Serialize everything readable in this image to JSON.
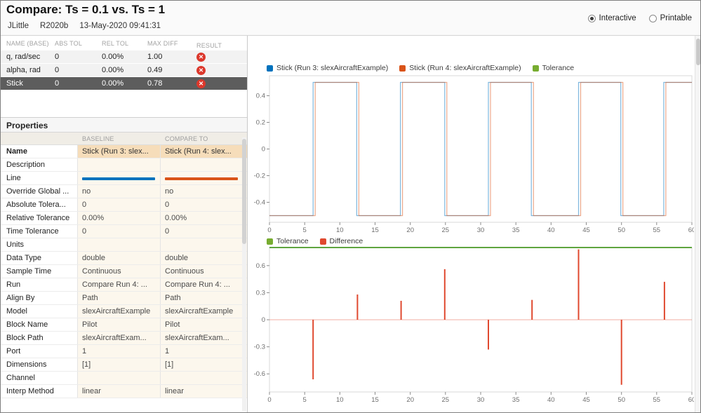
{
  "header": {
    "title": "Compare: Ts = 0.1 vs. Ts = 1",
    "user": "JLittle",
    "release": "R2020b",
    "timestamp": "13-May-2020 09:41:31",
    "view_options": [
      {
        "label": "Interactive",
        "selected": true
      },
      {
        "label": "Printable",
        "selected": false
      }
    ]
  },
  "icons": {
    "fail": "✕"
  },
  "results_table": {
    "columns": [
      "NAME (BASE)",
      "ABS TOL",
      "REL TOL",
      "MAX DIFF",
      "RESULT"
    ],
    "rows": [
      {
        "name": "q, rad/sec",
        "abs_tol": "0",
        "rel_tol": "0.00%",
        "max_diff": "1.00",
        "result": "fail",
        "selected": false
      },
      {
        "name": "alpha, rad",
        "abs_tol": "0",
        "rel_tol": "0.00%",
        "max_diff": "0.49",
        "result": "fail",
        "selected": false
      },
      {
        "name": "Stick",
        "abs_tol": "0",
        "rel_tol": "0.00%",
        "max_diff": "0.78",
        "result": "fail",
        "selected": true
      }
    ]
  },
  "properties": {
    "title": "Properties",
    "columns": [
      "BASELINE",
      "COMPARE TO"
    ],
    "rows": [
      {
        "label": "Name",
        "baseline": "Stick (Run 3: slex...",
        "compare": "Stick (Run 4: slex...",
        "highlight": true
      },
      {
        "label": "Description",
        "baseline": "",
        "compare": ""
      },
      {
        "label": "Line",
        "type": "line",
        "baseline_color": "#0072bd",
        "compare_color": "#d95319",
        "baseline": "",
        "compare": ""
      },
      {
        "label": "Override Global ...",
        "baseline": "no",
        "compare": "no"
      },
      {
        "label": "Absolute Tolera...",
        "baseline": "0",
        "compare": "0"
      },
      {
        "label": "Relative Tolerance",
        "baseline": "0.00%",
        "compare": "0.00%"
      },
      {
        "label": "Time Tolerance",
        "baseline": "0",
        "compare": "0"
      },
      {
        "label": "Units",
        "baseline": "",
        "compare": ""
      },
      {
        "label": "Data Type",
        "baseline": "double",
        "compare": "double"
      },
      {
        "label": "Sample Time",
        "baseline": "Continuous",
        "compare": "Continuous"
      },
      {
        "label": "Run",
        "baseline": "Compare Run 4: ...",
        "compare": "Compare Run 4: ..."
      },
      {
        "label": "Align By",
        "baseline": "Path",
        "compare": "Path"
      },
      {
        "label": "Model",
        "baseline": "slexAircraftExample",
        "compare": "slexAircraftExample"
      },
      {
        "label": "Block Name",
        "baseline": "Pilot",
        "compare": "Pilot"
      },
      {
        "label": "Block Path",
        "baseline": "slexAircraftExam...",
        "compare": "slexAircraftExam..."
      },
      {
        "label": "Port",
        "baseline": "1",
        "compare": "1"
      },
      {
        "label": "Dimensions",
        "baseline": "[1]",
        "compare": "[1]"
      },
      {
        "label": "Channel",
        "baseline": "",
        "compare": ""
      },
      {
        "label": "Interp Method",
        "baseline": "linear",
        "compare": "linear"
      }
    ]
  },
  "chart_data": [
    {
      "type": "line",
      "title": "signals-comparison",
      "legend": [
        {
          "label": "Stick (Run 3: slexAircraftExample)",
          "color": "#0072bd"
        },
        {
          "label": "Stick (Run 4: slexAircraftExample)",
          "color": "#d95319"
        },
        {
          "label": "Tolerance",
          "color": "#77ac30"
        }
      ],
      "xlim": [
        0,
        60
      ],
      "ylim": [
        -0.55,
        0.55
      ],
      "xticks": [
        0,
        5,
        10,
        15,
        20,
        25,
        30,
        35,
        40,
        45,
        50,
        55,
        60
      ],
      "yticks": [
        -0.4,
        -0.2,
        0,
        0.2,
        0.4
      ],
      "grid": false,
      "series": [
        {
          "name": "Stick (Run 3: slexAircraftExample)",
          "color": "#0072bd",
          "type": "square",
          "initial": -0.5,
          "low": -0.5,
          "high": 0.5,
          "transitions": [
            6.2,
            12.4,
            18.6,
            24.9,
            31.1,
            37.2,
            43.9,
            49.9,
            56.0
          ]
        },
        {
          "name": "Stick (Run 4: slexAircraftExample)",
          "color": "#d95319",
          "type": "square",
          "initial": -0.5,
          "low": -0.5,
          "high": 0.5,
          "transitions": [
            6.5,
            12.7,
            18.9,
            25.2,
            31.4,
            37.5,
            44.2,
            50.2,
            56.3
          ]
        }
      ]
    },
    {
      "type": "line",
      "title": "difference-plot",
      "legend": [
        {
          "label": "Tolerance",
          "color": "#77ac30"
        },
        {
          "label": "Difference",
          "color": "#e0492f"
        }
      ],
      "xlim": [
        0,
        60
      ],
      "ylim": [
        -0.8,
        0.8
      ],
      "xticks": [
        0,
        5,
        10,
        15,
        20,
        25,
        30,
        35,
        40,
        45,
        50,
        55,
        60
      ],
      "yticks": [
        -0.6,
        -0.3,
        0,
        0.3,
        0.6
      ],
      "grid": false,
      "series": [
        {
          "name": "Tolerance",
          "type": "hline",
          "y": 0.8,
          "color": "#5fa53f",
          "width": 2,
          "opacity": 1
        },
        {
          "name": "Difference zero line",
          "type": "hline",
          "y": 0,
          "color": "#e0492f",
          "width": 1,
          "opacity": 0.45
        },
        {
          "name": "Difference",
          "type": "vlines",
          "color": "#e0492f",
          "width": 2,
          "points": [
            {
              "x": 6.2,
              "y": -0.66
            },
            {
              "x": 12.5,
              "y": 0.28
            },
            {
              "x": 18.7,
              "y": 0.21
            },
            {
              "x": 24.9,
              "y": 0.56
            },
            {
              "x": 31.1,
              "y": -0.33
            },
            {
              "x": 37.3,
              "y": 0.22
            },
            {
              "x": 43.9,
              "y": 0.78
            },
            {
              "x": 50.0,
              "y": -0.72
            },
            {
              "x": 56.1,
              "y": 0.42
            }
          ]
        }
      ]
    }
  ]
}
